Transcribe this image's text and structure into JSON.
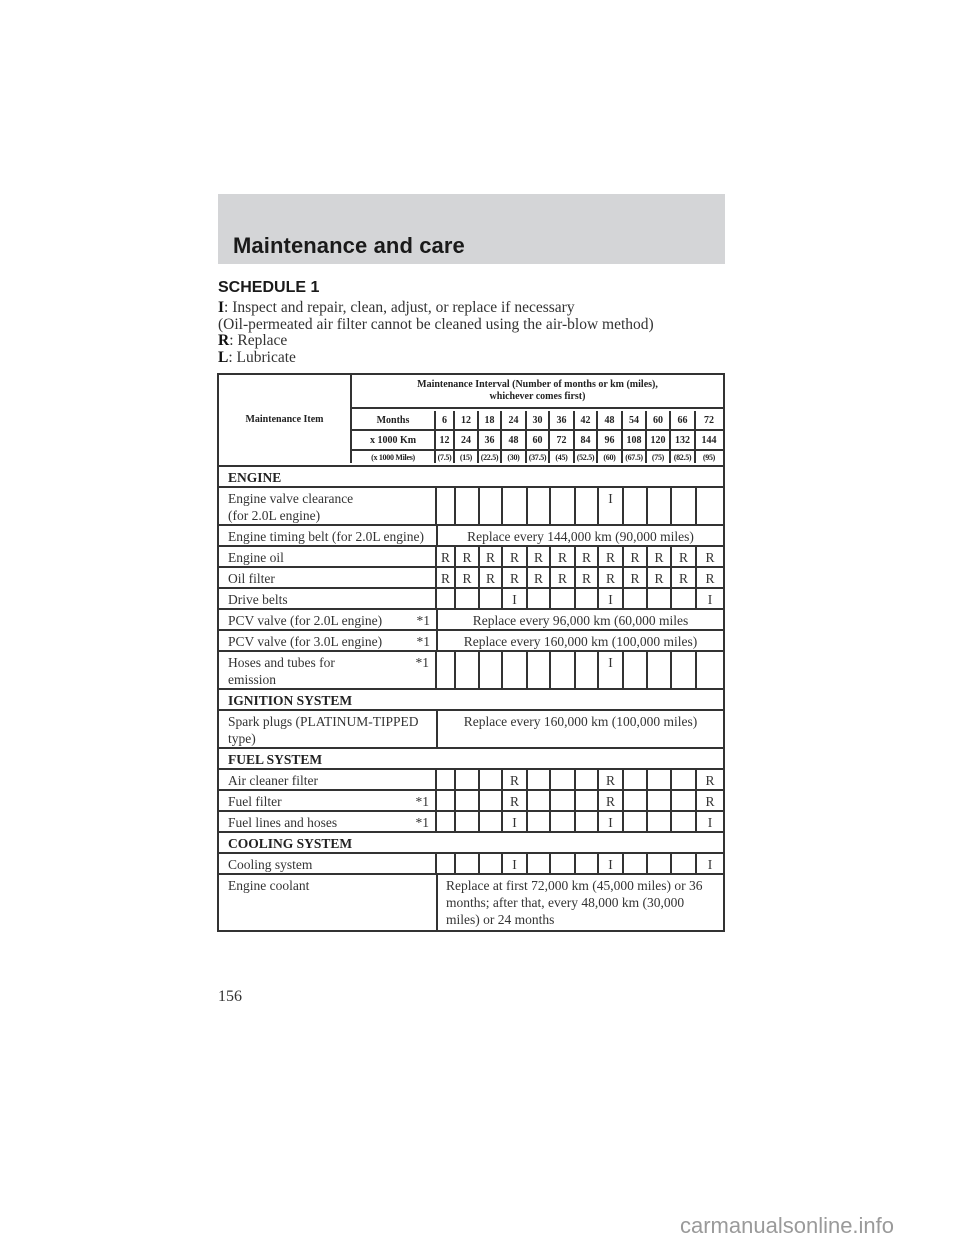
{
  "header": {
    "title": "Maintenance and care"
  },
  "schedule_title": "SCHEDULE 1",
  "legend": [
    {
      "key": "I",
      "text": ": Inspect and repair, clean, adjust, or replace if necessary"
    },
    {
      "key": "",
      "text": "(Oil-permeated air filter cannot be cleaned using the air-blow method)"
    },
    {
      "key": "R",
      "text": ": Replace"
    },
    {
      "key": "L",
      "text": ": Lubricate"
    }
  ],
  "table": {
    "item_header": "Maintenance Item",
    "interval_header_line1": "Maintenance Interval (Number of months or km (miles),",
    "interval_header_line2": "whichever comes first)",
    "months_label": "Months",
    "km_label": "x 1000 Km",
    "miles_label": "(x 1000 Miles)",
    "months": [
      "6",
      "12",
      "18",
      "24",
      "30",
      "36",
      "42",
      "48",
      "54",
      "60",
      "66",
      "72"
    ],
    "km": [
      "12",
      "24",
      "36",
      "48",
      "60",
      "72",
      "84",
      "96",
      "108",
      "120",
      "132",
      "144"
    ],
    "miles": [
      "(7.5)",
      "(15)",
      "(22.5)",
      "(30)",
      "(37.5)",
      "(45)",
      "(52.5)",
      "(60)",
      "(67.5)",
      "(75)",
      "(82.5)",
      "(95)"
    ],
    "rows": [
      {
        "type": "section",
        "label": "ENGINE"
      },
      {
        "type": "marks",
        "label": "Engine valve clearance",
        "label2": "(for 2.0L engine)",
        "note": "",
        "marks": [
          "",
          "",
          "",
          "",
          "",
          "",
          "",
          "I",
          "",
          "",
          "",
          ""
        ],
        "tall": true
      },
      {
        "type": "span",
        "label": "Engine timing belt (for 2.0L engine)",
        "note": "",
        "text": "Replace every 144,000 km (90,000 miles)"
      },
      {
        "type": "marks",
        "label": "Engine oil",
        "note": "",
        "marks": [
          "R",
          "R",
          "R",
          "R",
          "R",
          "R",
          "R",
          "R",
          "R",
          "R",
          "R",
          "R"
        ]
      },
      {
        "type": "marks",
        "label": "Oil filter",
        "note": "",
        "marks": [
          "R",
          "R",
          "R",
          "R",
          "R",
          "R",
          "R",
          "R",
          "R",
          "R",
          "R",
          "R"
        ]
      },
      {
        "type": "marks",
        "label": "Drive belts",
        "note": "",
        "marks": [
          "",
          "",
          "",
          "I",
          "",
          "",
          "",
          "I",
          "",
          "",
          "",
          "I"
        ]
      },
      {
        "type": "span",
        "label": "PCV valve (for 2.0L engine)",
        "note": "*1",
        "text": "Replace every 96,000 km (60,000 miles"
      },
      {
        "type": "span",
        "label": "PCV valve (for 3.0L engine)",
        "note": "*1",
        "text": "Replace every 160,000 km (100,000 miles)"
      },
      {
        "type": "marks",
        "label": "Hoses and tubes for",
        "label2": "emission",
        "note": "*1",
        "marks": [
          "",
          "",
          "",
          "",
          "",
          "",
          "",
          "I",
          "",
          "",
          "",
          ""
        ],
        "tall": true
      },
      {
        "type": "section",
        "label": "IGNITION SYSTEM"
      },
      {
        "type": "span",
        "label": "Spark plugs (PLATINUM-TIPPED",
        "label2": "type)",
        "note": "",
        "text": "Replace every 160,000 km (100,000 miles)",
        "tall": true
      },
      {
        "type": "section",
        "label": "FUEL SYSTEM"
      },
      {
        "type": "marks",
        "label": "Air cleaner filter",
        "note": "",
        "marks": [
          "",
          "",
          "",
          "R",
          "",
          "",
          "",
          "R",
          "",
          "",
          "",
          "R"
        ]
      },
      {
        "type": "marks",
        "label": "Fuel filter",
        "note": "*1",
        "marks": [
          "",
          "",
          "",
          "R",
          "",
          "",
          "",
          "R",
          "",
          "",
          "",
          "R"
        ]
      },
      {
        "type": "marks",
        "label": "Fuel lines and hoses",
        "note": "*1",
        "marks": [
          "",
          "",
          "",
          "I",
          "",
          "",
          "",
          "I",
          "",
          "",
          "",
          "I"
        ]
      },
      {
        "type": "section",
        "label": "COOLING SYSTEM"
      },
      {
        "type": "marks",
        "label": "Cooling system",
        "note": "",
        "marks": [
          "",
          "",
          "",
          "I",
          "",
          "",
          "",
          "I",
          "",
          "",
          "",
          "I"
        ]
      },
      {
        "type": "multiline",
        "label": "Engine coolant",
        "note": "",
        "lines": [
          "Replace at first 72,000 km (45,000 miles) or 36",
          "months; after that, every 48,000 km (30,000",
          "miles) or 24 months"
        ]
      }
    ]
  },
  "page_number": "156",
  "watermark": "carmanualsonline.info"
}
